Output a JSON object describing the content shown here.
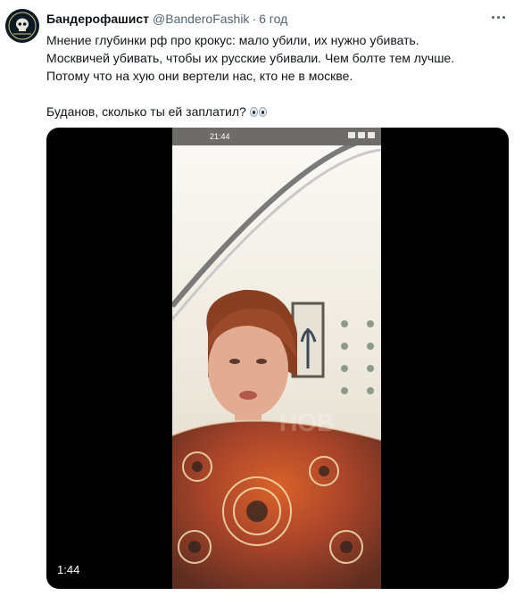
{
  "tweet": {
    "display_name": "Бандерофашист",
    "handle": "@BanderoFashik",
    "separator": "·",
    "time": "6 год",
    "text_lines": [
      "Мнение глубинки рф про крокус: мало убили, их нужно убивать.",
      "Москвичей убивать, чтобы их русские убивали. Чем болте тем лучше.",
      "Потому что на хую они вертели нас, кто не в москве."
    ],
    "question": "Буданов, сколько ты ей заплатил?",
    "emoji": "eyes-emoji"
  },
  "video": {
    "status_clock": "21:44",
    "duration": "1:44",
    "icons": {
      "more": "more-dots-icon",
      "avatar": "skull-avatar-icon"
    }
  },
  "colors": {
    "text": "#0f1419",
    "secondary": "#536471",
    "media_bg": "#000000"
  }
}
